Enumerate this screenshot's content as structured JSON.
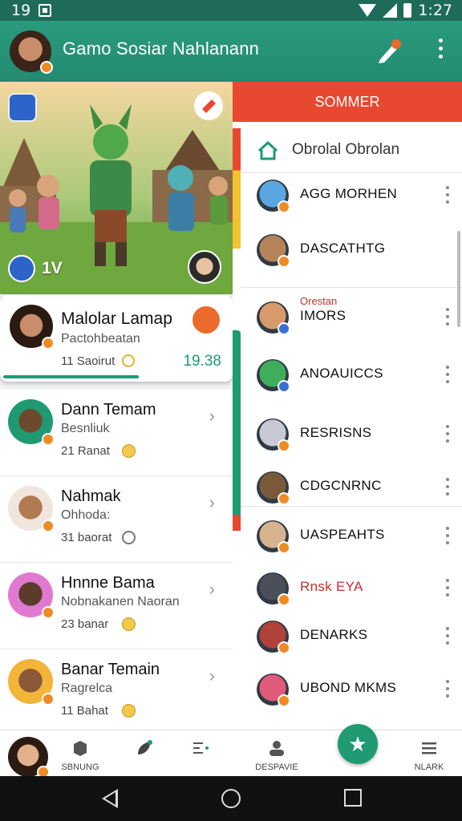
{
  "status_bar": {
    "time_left": "19",
    "time_right": "1:27"
  },
  "app_bar": {
    "title": "Gamo Sosiar Nahlanann",
    "icons": [
      "pen-icon",
      "more-icon"
    ]
  },
  "hero": {
    "count": "1V",
    "icons": [
      "screen-icon",
      "heart-icon",
      "drop-icon"
    ]
  },
  "featured": {
    "name": "Malolar Lamap",
    "subtitle": "Pactohbeatan",
    "meta": "11 Saoirut",
    "score": "19.38",
    "progress": 0.6
  },
  "chats": [
    {
      "name": "Dann Temam",
      "subtitle": "Besnliuk",
      "meta": "21 Ranat",
      "meta_icon": "emoji-icon",
      "face": "#6d4a2e",
      "bg": "#1f9a72"
    },
    {
      "name": "Nahmak",
      "subtitle": "Ohhoda:",
      "meta": "31 baorat",
      "meta_icon": "clock-icon",
      "face": "#b07a52",
      "bg": "#f0e6de"
    },
    {
      "name": "Hnnne Bama",
      "subtitle": "Nobnakanen Naoran",
      "meta": "23 banar",
      "meta_icon": "emoji-icon",
      "face": "#5b3b2a",
      "bg": "#e07ad0"
    },
    {
      "name": "Banar Temain",
      "subtitle": "Ragrelca",
      "meta": "11 Bahat",
      "meta_icon": "emoji-icon",
      "face": "#8a5a38",
      "bg": "#f2b53a"
    }
  ],
  "right_panel": {
    "header": "SOMMER",
    "title": "Obrolal Obrolan",
    "contacts": [
      {
        "name": "AGG MORHEN",
        "tag": "",
        "color": "#5aa7e0",
        "badge": "orange",
        "red": false
      },
      {
        "name": "DASCATHTG",
        "tag": "",
        "color": "#b5835a",
        "badge": "orange",
        "red": false
      },
      {
        "name": "IMORS",
        "tag": "Orestan",
        "color": "#d89a6a",
        "badge": "blue",
        "red": false
      },
      {
        "name": "ANOAUICCS",
        "tag": "",
        "color": "#3fae5a",
        "badge": "blue",
        "red": false
      },
      {
        "name": "RESRISNS",
        "tag": "",
        "color": "#c9c9d6",
        "badge": "orange",
        "red": false
      },
      {
        "name": "CDGCNRNC",
        "tag": "",
        "color": "#7a5a3a",
        "badge": "orange",
        "red": false
      },
      {
        "name": "UASPEAHTS",
        "tag": "",
        "color": "#d6b38e",
        "badge": "orange",
        "red": false
      },
      {
        "name": "Rnsk EYA",
        "tag": "",
        "color": "#4a4f5a",
        "badge": "orange",
        "red": true
      },
      {
        "name": "DENARKS",
        "tag": "",
        "color": "#b0423a",
        "badge": "orange",
        "red": false
      },
      {
        "name": "UBOND MKMS",
        "tag": "",
        "color": "#e05a7a",
        "badge": "orange",
        "red": false
      }
    ]
  },
  "bottom_nav": {
    "items": [
      {
        "label": "SBNUNG",
        "icon": "cube-icon"
      },
      {
        "label": "",
        "icon": "leaf-icon"
      },
      {
        "label": "",
        "icon": "list-icon"
      },
      {
        "label": "DESPAVIE",
        "icon": "group-icon"
      },
      {
        "label": "NLARK",
        "icon": "menu-icon"
      }
    ],
    "fab_icon": "star-icon",
    "fab_glyph": "★"
  }
}
